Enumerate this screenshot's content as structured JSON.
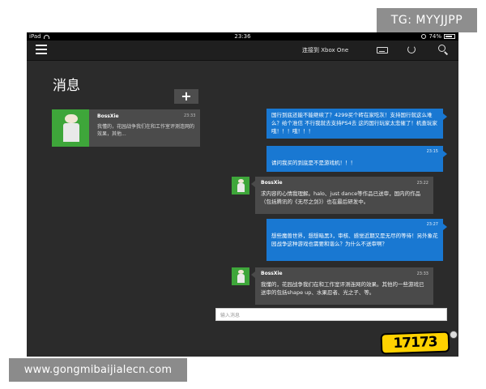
{
  "overlay": {
    "tag_text": "TG: MYYJJPP",
    "website_text": "www.gongmibaijialecn.com",
    "logo_text": "17173"
  },
  "statusbar": {
    "device": "iPad",
    "time": "23:36",
    "battery": "74%"
  },
  "navbar": {
    "connect_label": "连接到 Xbox One",
    "icons": [
      "menu-icon",
      "console-icon",
      "refresh-icon",
      "search-icon"
    ]
  },
  "page": {
    "title": "消息",
    "add_label": "+"
  },
  "conversation_list": [
    {
      "name": "BossXie",
      "time": "23:33",
      "preview": "我懂的，花园战争我们在和工作室评测连网的效果，其他..."
    }
  ],
  "messages": [
    {
      "direction": "out",
      "time": "",
      "text": "国行到底还能不能继续了？4299买个砖在家吃灰！支持国行就这么难么？给个准信 不行我就去支持PS4去 这的国行玩家太悲催了！机查玩家哦！！！哦！！！"
    },
    {
      "direction": "out",
      "time": "23:15",
      "text": "请问我买的到底是不是游戏机！！！"
    },
    {
      "direction": "in",
      "name": "BossXie",
      "time": "23:22",
      "text": "求内容的心情我理解。halo、just dance等作品已送审，国内的作品（包括腾讯的《无尽之剑》）也在最后研发中。"
    },
    {
      "direction": "out",
      "time": "23:27",
      "text": "想些魔兽世界，想想暗黑3，审核、感觉近期又是无尽的等待！另外象花园战争这种游戏也需要和谐么？为什么不送审啊？"
    },
    {
      "direction": "in",
      "name": "BossXie",
      "time": "23:33",
      "text": "我懂的，花园战争我们在和工作室评测连网的效果。其他的一些游戏已送审的包括shape up、水果忍者、光之子、等。"
    }
  ],
  "composer": {
    "placeholder": "输入消息"
  }
}
